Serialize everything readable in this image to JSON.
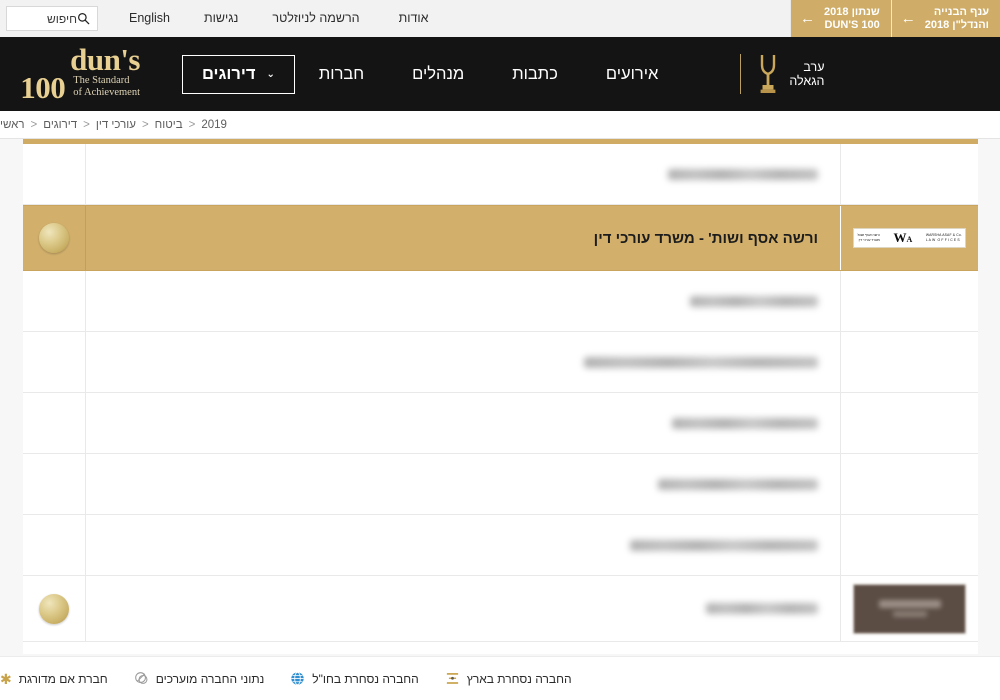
{
  "topbar": {
    "tabs": [
      {
        "label": "ענף הבנייה\nוהנדל\"ן 2018",
        "arrow": "←"
      },
      {
        "label": "שנתון 2018\nDUN'S 100",
        "arrow": "←"
      }
    ],
    "nav": [
      {
        "label": "אודות"
      },
      {
        "label": "הרשמה לניוזלטר"
      },
      {
        "label": "נגישות"
      },
      {
        "label": "English"
      }
    ],
    "search": {
      "placeholder": "חיפוש",
      "icon": "search-icon"
    }
  },
  "mainnav": {
    "logo": {
      "top": "dun's",
      "hundred": "100",
      "tagline_line1": "The Standard",
      "tagline_line2": "of Achievement"
    },
    "links": [
      {
        "label": "דירוגים",
        "boxed": true,
        "chevron": "⌄"
      },
      {
        "label": "חברות",
        "boxed": false
      },
      {
        "label": "מנהלים",
        "boxed": false
      },
      {
        "label": "כתבות",
        "boxed": false
      },
      {
        "label": "אירועים",
        "boxed": false
      }
    ],
    "gala": {
      "label": "ערב\nהגאלה",
      "icon": "trophy-icon"
    }
  },
  "breadcrumb": {
    "separator": "<",
    "items": [
      {
        "label": "ראשי"
      },
      {
        "label": "דירוגים"
      },
      {
        "label": "עורכי דין"
      },
      {
        "label": "ביטוח"
      },
      {
        "label": "2019"
      }
    ]
  },
  "table": {
    "rows": [
      {
        "name": "",
        "blurred": true,
        "blur_width": 150,
        "badge": false,
        "logo": "none",
        "highlight": false
      },
      {
        "name": "ורשה אסף ושות' - משרד עורכי דין",
        "blurred": false,
        "badge": true,
        "logo": "white-card",
        "highlight": true
      },
      {
        "name": "",
        "blurred": true,
        "blur_width": 128,
        "badge": false,
        "logo": "none",
        "highlight": false
      },
      {
        "name": "",
        "blurred": true,
        "blur_width": 234,
        "badge": false,
        "logo": "none",
        "highlight": false
      },
      {
        "name": "",
        "blurred": true,
        "blur_width": 146,
        "badge": false,
        "logo": "none",
        "highlight": false
      },
      {
        "name": "",
        "blurred": true,
        "blur_width": 160,
        "badge": false,
        "logo": "none",
        "highlight": false
      },
      {
        "name": "",
        "blurred": true,
        "blur_width": 188,
        "badge": false,
        "logo": "none",
        "highlight": false
      },
      {
        "name": "",
        "blurred": true,
        "blur_width": 112,
        "badge": true,
        "logo": "brown-card",
        "highlight": false
      }
    ]
  },
  "legend": {
    "items": [
      {
        "label": "חברת אם מדורגת",
        "icon": "asterisk-icon"
      },
      {
        "label": "נתוני החברה מוערכים",
        "icon": "estimate-circles-icon"
      },
      {
        "label": "החברה נסחרת בחו\"ל",
        "icon": "globe-icon"
      },
      {
        "label": "החברה נסחרת בארץ",
        "icon": "stock-chart-icon"
      }
    ]
  },
  "colors": {
    "gold": "#d2b06c",
    "gold_tab": "#cfad68",
    "nav_black": "#141414",
    "logo_gold": "#e8cf92",
    "globe_blue": "#2f8fd0"
  }
}
